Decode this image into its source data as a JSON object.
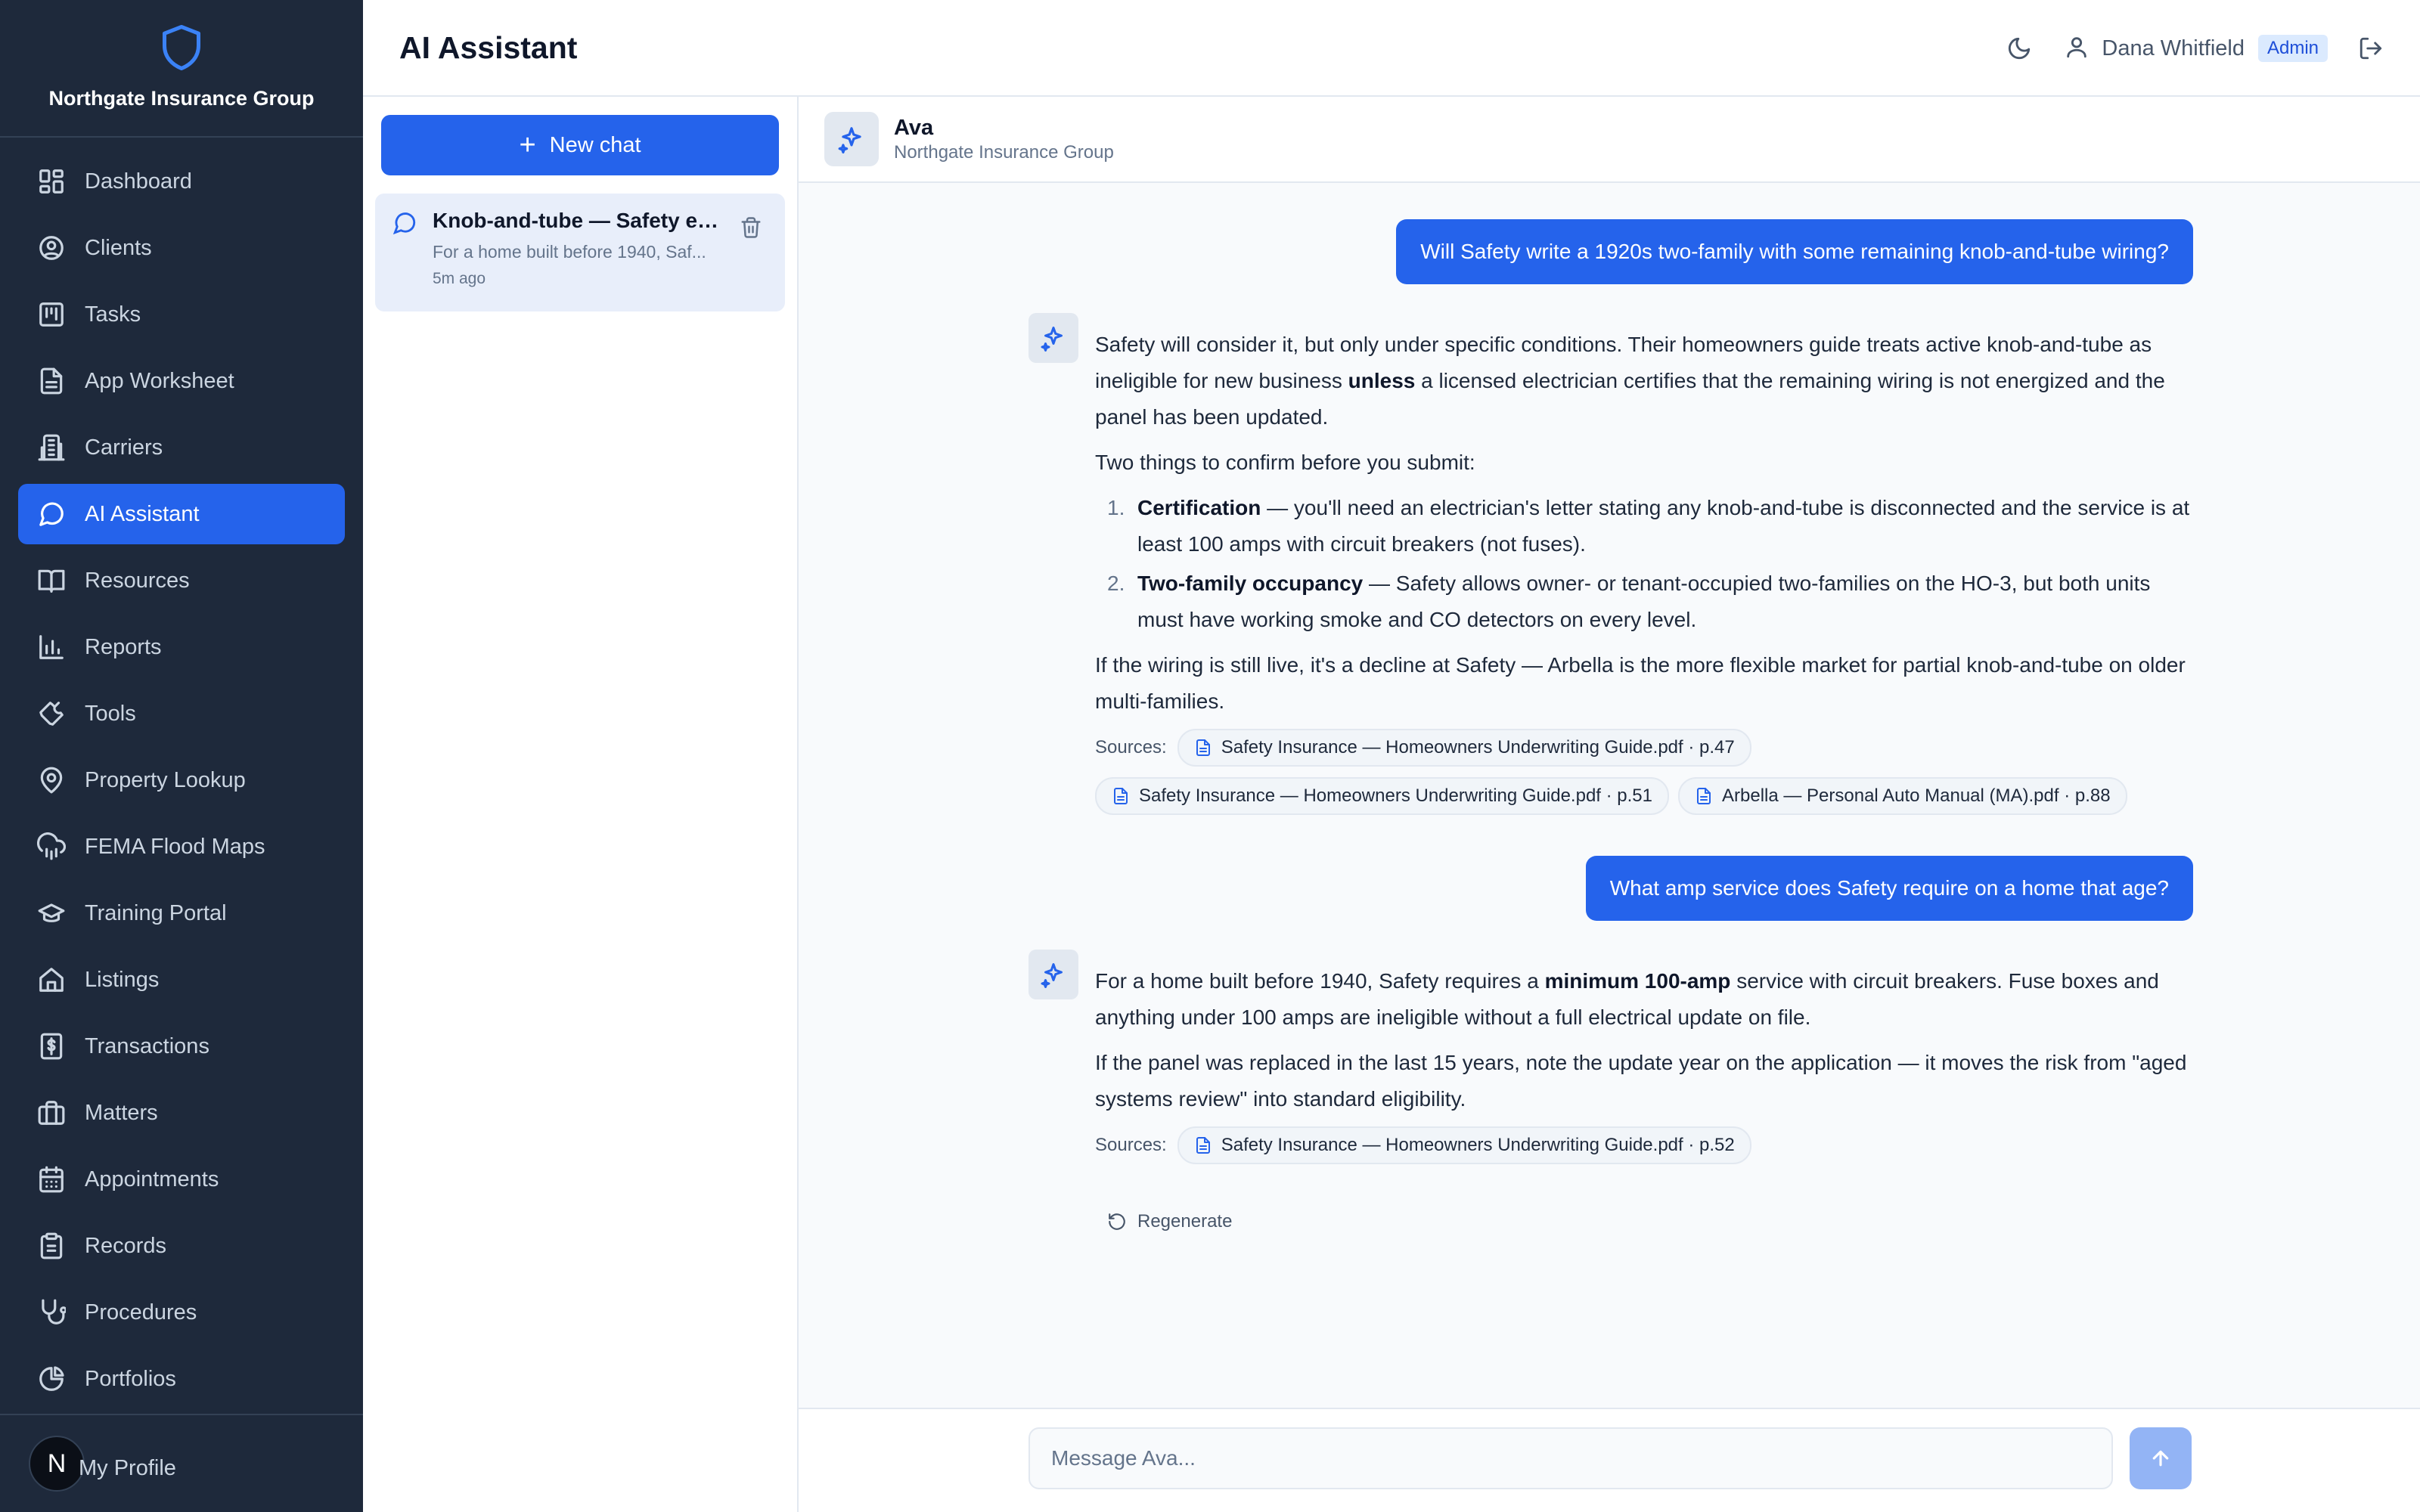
{
  "brand": {
    "name": "Northgate Insurance Group",
    "icon": "shield-icon"
  },
  "sidebar": {
    "items": [
      {
        "label": "Dashboard",
        "icon": "dashboard-icon"
      },
      {
        "label": "Clients",
        "icon": "user-circle-icon"
      },
      {
        "label": "Tasks",
        "icon": "kanban-icon"
      },
      {
        "label": "App Worksheet",
        "icon": "document-icon"
      },
      {
        "label": "Carriers",
        "icon": "building-icon"
      },
      {
        "label": "AI Assistant",
        "icon": "chat-icon",
        "active": true
      },
      {
        "label": "Resources",
        "icon": "book-icon"
      },
      {
        "label": "Reports",
        "icon": "bar-chart-icon"
      },
      {
        "label": "Tools",
        "icon": "wrench-icon"
      },
      {
        "label": "Property Lookup",
        "icon": "map-pin-icon"
      },
      {
        "label": "FEMA Flood Maps",
        "icon": "cloud-rain-icon"
      },
      {
        "label": "Training Portal",
        "icon": "graduation-cap-icon"
      },
      {
        "label": "Listings",
        "icon": "home-icon"
      },
      {
        "label": "Transactions",
        "icon": "dollar-receipt-icon"
      },
      {
        "label": "Matters",
        "icon": "briefcase-icon"
      },
      {
        "label": "Appointments",
        "icon": "calendar-icon"
      },
      {
        "label": "Records",
        "icon": "clipboard-icon"
      },
      {
        "label": "Procedures",
        "icon": "stethoscope-icon"
      },
      {
        "label": "Portfolios",
        "icon": "pie-chart-icon"
      }
    ],
    "profile": {
      "initial": "N",
      "label": "My Profile"
    }
  },
  "header": {
    "title": "AI Assistant",
    "user_name": "Dana Whitfield",
    "role": "Admin"
  },
  "chatlist": {
    "new_chat_label": "New chat",
    "chats": [
      {
        "title": "Knob-and-tube — Safety el...",
        "preview": "For a home built before 1940, Saf...",
        "time": "5m ago"
      }
    ]
  },
  "assistant": {
    "name": "Ava",
    "org": "Northgate Insurance Group"
  },
  "messages": {
    "user1": "Will Safety write a 1920s two-family with some remaining knob-and-tube wiring?",
    "a1": {
      "p1_pre": "Safety will consider it, but only under specific conditions. Their homeowners guide treats active knob-and-tube as ineligible for new business ",
      "p1_bold": "unless",
      "p1_post": " a licensed electrician certifies that the remaining wiring is not energized and the panel has been updated.",
      "p2": "Two things to confirm before you submit:",
      "li1_num": "1.",
      "li1_bold": "Certification",
      "li1_text": " — you'll need an electrician's letter stating any knob-and-tube is disconnected and the service is at least 100 amps with circuit breakers (not fuses).",
      "li2_num": "2.",
      "li2_bold": "Two-family occupancy",
      "li2_text": " — Safety allows owner- or tenant-occupied two-families on the HO-3, but both units must have working smoke and CO detectors on every level.",
      "p3": "If the wiring is still live, it's a decline at Safety — Arbella is the more flexible market for partial knob-and-tube on older multi-families.",
      "sources_label": "Sources:",
      "sources": [
        "Safety Insurance — Homeowners Underwriting Guide.pdf · p.47",
        "Safety Insurance — Homeowners Underwriting Guide.pdf · p.51",
        "Arbella — Personal Auto Manual (MA).pdf · p.88"
      ]
    },
    "user2": "What amp service does Safety require on a home that age?",
    "a2": {
      "p1_pre": "For a home built before 1940, Safety requires a ",
      "p1_bold": "minimum 100-amp",
      "p1_post": " service with circuit breakers. Fuse boxes and anything under 100 amps are ineligible without a full electrical update on file.",
      "p2": "If the panel was replaced in the last 15 years, note the update year on the application — it moves the risk from \"aged systems review\" into standard eligibility.",
      "sources_label": "Sources:",
      "sources": [
        "Safety Insurance — Homeowners Underwriting Guide.pdf · p.52"
      ]
    },
    "regenerate_label": "Regenerate"
  },
  "composer": {
    "placeholder": "Message Ava..."
  },
  "colors": {
    "accent": "#2563eb",
    "sidebar_bg": "#1e293b",
    "page_bg": "#f8fafc"
  }
}
